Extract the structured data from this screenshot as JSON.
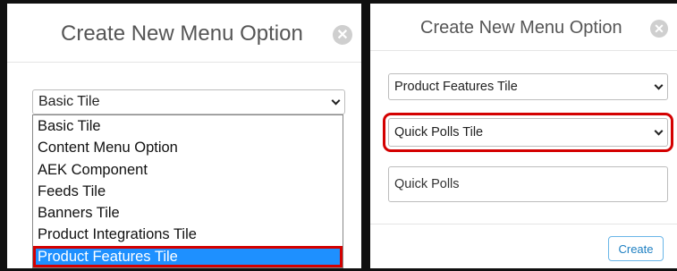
{
  "left_modal": {
    "title": "Create New Menu Option",
    "close_icon": "close-circle-icon",
    "select_value": "Basic Tile",
    "options": [
      "Basic Tile",
      "Content Menu Option",
      "AEK Component",
      "Feeds Tile",
      "Banners Tile",
      "Product Integrations Tile",
      "Product Features Tile"
    ],
    "highlighted_option": "Product Features Tile"
  },
  "right_modal": {
    "title": "Create New Menu Option",
    "close_icon": "close-circle-icon",
    "tile_type_select": "Product Features Tile",
    "tile_select": "Quick Polls Tile",
    "name_value": "Quick Polls",
    "create_label": "Create"
  },
  "colors": {
    "highlight_border": "#d40000",
    "selected_option_bg": "#1e90ff",
    "create_button_text": "#1d7fc2",
    "backdrop": "#101010"
  }
}
